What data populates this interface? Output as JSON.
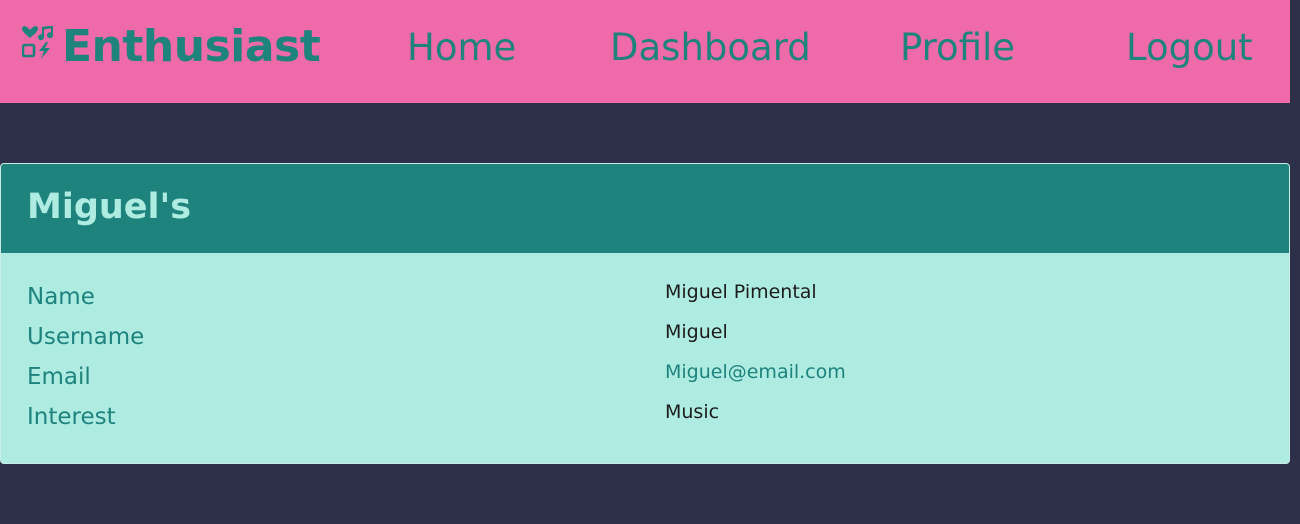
{
  "navbar": {
    "brand": {
      "icon": "heart-music-bolt-icon",
      "label": "Enthusiast"
    },
    "links": [
      {
        "label": "Home"
      },
      {
        "label": "Dashboard"
      },
      {
        "label": "Profile"
      },
      {
        "label": "Logout"
      }
    ]
  },
  "profile": {
    "title": "Miguel's",
    "fields": [
      {
        "label": "Name",
        "value": "Miguel Pimental"
      },
      {
        "label": "Username",
        "value": "Miguel"
      },
      {
        "label": "Email",
        "value": "Miguel@email.com"
      },
      {
        "label": "Interest",
        "value": "Music"
      }
    ]
  },
  "colors": {
    "page_background": "#2e3049",
    "navbar_background": "#ef6aa8",
    "accent": "#1f837d",
    "card_background": "#aeece2"
  }
}
